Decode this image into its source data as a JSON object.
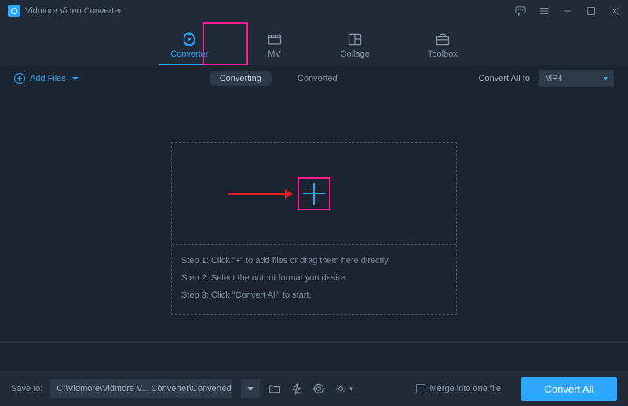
{
  "app": {
    "title": "Vidmore Video Converter"
  },
  "mainTabs": [
    {
      "label": "Converter"
    },
    {
      "label": "MV"
    },
    {
      "label": "Collage"
    },
    {
      "label": "Toolbox"
    }
  ],
  "toolbar": {
    "addFilesLabel": "Add Files",
    "subTabs": {
      "converting": "Converting",
      "converted": "Converted"
    },
    "convertAllToLabel": "Convert All to:",
    "format": "MP4"
  },
  "steps": {
    "s1": "Step 1: Click \"+\" to add files or drag them here directly.",
    "s2": "Step 2: Select the output format you desire.",
    "s3": "Step 3: Click \"Convert All\" to start."
  },
  "footer": {
    "saveToLabel": "Save to:",
    "savePath": "C:\\Vidmore\\Vidmore V... Converter\\Converted",
    "mergeLabel": "Merge into one file",
    "convertAllBtn": "Convert All"
  }
}
